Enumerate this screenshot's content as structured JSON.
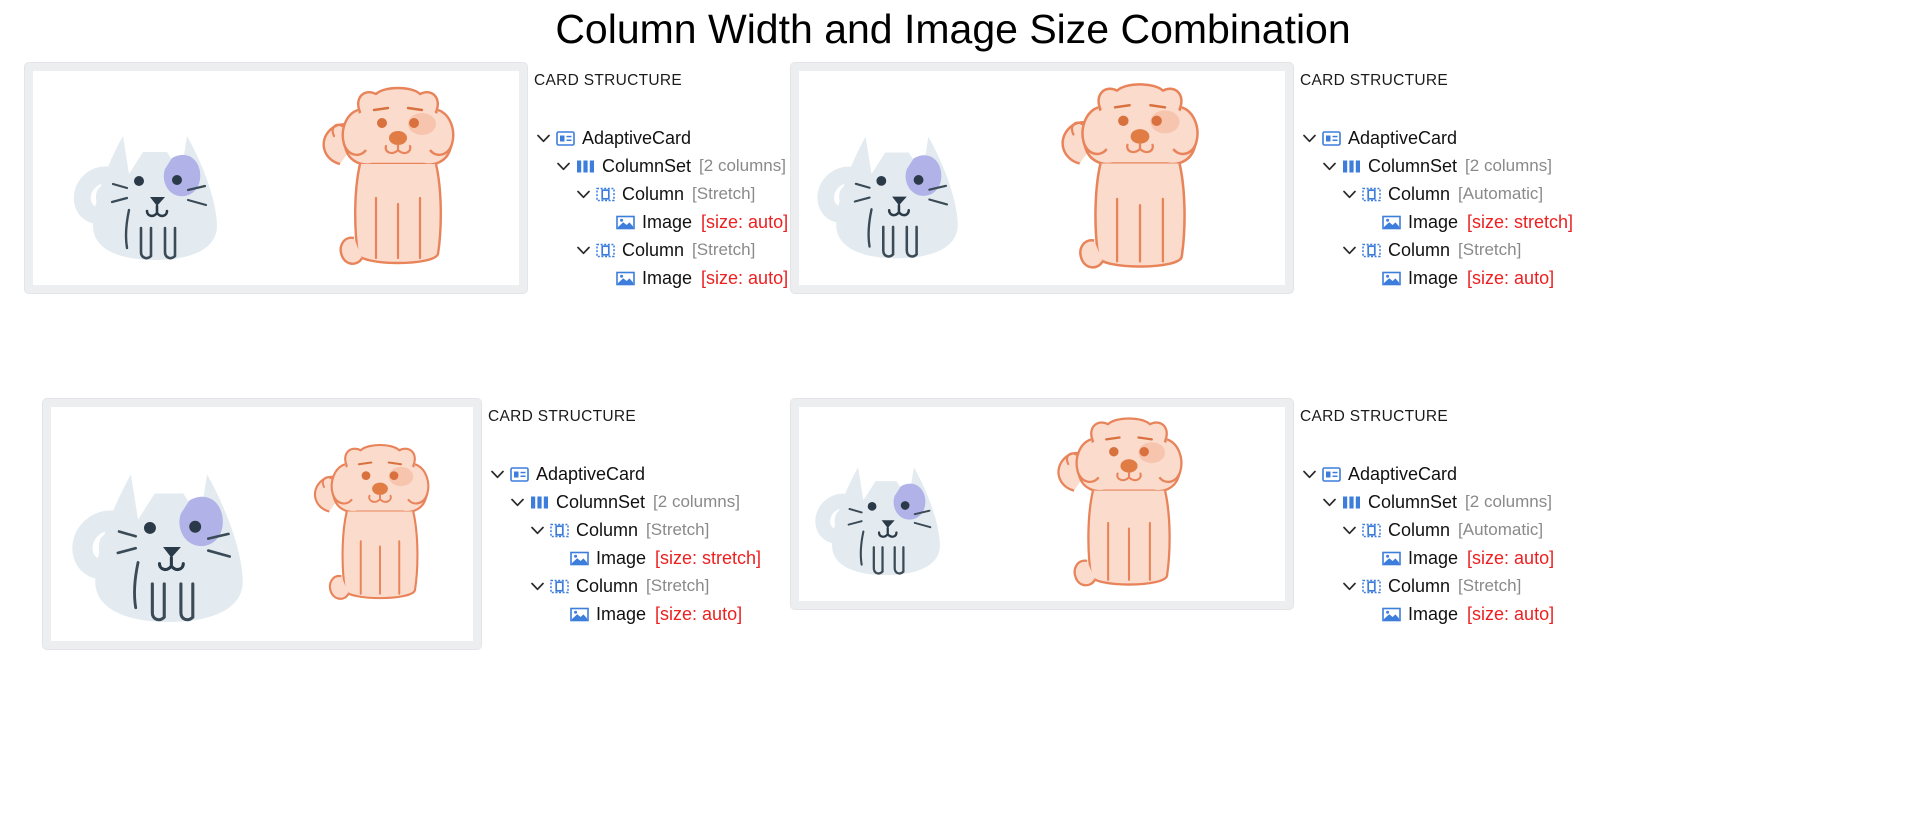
{
  "page": {
    "title": "Column Width and Image Size Combination"
  },
  "common": {
    "structure_heading": "CARD STRUCTURE",
    "node_adaptive_card": "AdaptiveCard",
    "node_columnset": "ColumnSet",
    "node_column": "Column",
    "node_image": "Image",
    "meta_two_columns": "[2 columns]",
    "width_stretch": "[Stretch]",
    "width_automatic": "[Automatic]",
    "size_auto": "[size: auto]",
    "size_stretch": "[size: stretch]",
    "accent_blue": "#3d7ddb",
    "red": "#ec2020",
    "meta_gray": "#8a8a8a",
    "card_frame_bg": "#eceef0",
    "cat_body": "#e3ebf0",
    "cat_ear_patch": "#b0b2e8",
    "cat_line": "#3b4a57",
    "dog_body": "#fadbcc",
    "dog_line": "#e8835a"
  },
  "panels": [
    {
      "id": "panel-1",
      "heading": "CARD STRUCTURE",
      "nodes": [
        {
          "level": 0,
          "chevron": true,
          "icon": "adaptive-card-icon",
          "label": "AdaptiveCard",
          "meta": "",
          "size": ""
        },
        {
          "level": 1,
          "chevron": true,
          "icon": "columnset-icon",
          "label": "ColumnSet",
          "meta": "[2 columns]",
          "size": ""
        },
        {
          "level": 2,
          "chevron": true,
          "icon": "column-icon",
          "label": "Column",
          "meta": "[Stretch]",
          "size": ""
        },
        {
          "level": 3,
          "chevron": false,
          "icon": "image-icon",
          "label": "Image",
          "meta": "",
          "size": "[size: auto]"
        },
        {
          "level": 2,
          "chevron": true,
          "icon": "column-icon",
          "label": "Column",
          "meta": "[Stretch]",
          "size": ""
        },
        {
          "level": 3,
          "chevron": false,
          "icon": "image-icon",
          "label": "Image",
          "meta": "",
          "size": "[size: auto]"
        }
      ]
    },
    {
      "id": "panel-2",
      "heading": "CARD STRUCTURE",
      "nodes": [
        {
          "level": 0,
          "chevron": true,
          "icon": "adaptive-card-icon",
          "label": "AdaptiveCard",
          "meta": "",
          "size": ""
        },
        {
          "level": 1,
          "chevron": true,
          "icon": "columnset-icon",
          "label": "ColumnSet",
          "meta": "[2 columns]",
          "size": ""
        },
        {
          "level": 2,
          "chevron": true,
          "icon": "column-icon",
          "label": "Column",
          "meta": "[Automatic]",
          "size": ""
        },
        {
          "level": 3,
          "chevron": false,
          "icon": "image-icon",
          "label": "Image",
          "meta": "",
          "size": "[size: stretch]"
        },
        {
          "level": 2,
          "chevron": true,
          "icon": "column-icon",
          "label": "Column",
          "meta": "[Stretch]",
          "size": ""
        },
        {
          "level": 3,
          "chevron": false,
          "icon": "image-icon",
          "label": "Image",
          "meta": "",
          "size": "[size: auto]"
        }
      ]
    },
    {
      "id": "panel-3",
      "heading": "CARD STRUCTURE",
      "nodes": [
        {
          "level": 0,
          "chevron": true,
          "icon": "adaptive-card-icon",
          "label": "AdaptiveCard",
          "meta": "",
          "size": ""
        },
        {
          "level": 1,
          "chevron": true,
          "icon": "columnset-icon",
          "label": "ColumnSet",
          "meta": "[2 columns]",
          "size": ""
        },
        {
          "level": 2,
          "chevron": true,
          "icon": "column-icon",
          "label": "Column",
          "meta": "[Stretch]",
          "size": ""
        },
        {
          "level": 3,
          "chevron": false,
          "icon": "image-icon",
          "label": "Image",
          "meta": "",
          "size": "[size: stretch]"
        },
        {
          "level": 2,
          "chevron": true,
          "icon": "column-icon",
          "label": "Column",
          "meta": "[Stretch]",
          "size": ""
        },
        {
          "level": 3,
          "chevron": false,
          "icon": "image-icon",
          "label": "Image",
          "meta": "",
          "size": "[size: auto]"
        }
      ]
    },
    {
      "id": "panel-4",
      "heading": "CARD STRUCTURE",
      "nodes": [
        {
          "level": 0,
          "chevron": true,
          "icon": "adaptive-card-icon",
          "label": "AdaptiveCard",
          "meta": "",
          "size": ""
        },
        {
          "level": 1,
          "chevron": true,
          "icon": "columnset-icon",
          "label": "ColumnSet",
          "meta": "[2 columns]",
          "size": ""
        },
        {
          "level": 2,
          "chevron": true,
          "icon": "column-icon",
          "label": "Column",
          "meta": "[Automatic]",
          "size": ""
        },
        {
          "level": 3,
          "chevron": false,
          "icon": "image-icon",
          "label": "Image",
          "meta": "",
          "size": "[size: auto]"
        },
        {
          "level": 2,
          "chevron": true,
          "icon": "column-icon",
          "label": "Column",
          "meta": "[Stretch]",
          "size": ""
        },
        {
          "level": 3,
          "chevron": false,
          "icon": "image-icon",
          "label": "Image",
          "meta": "",
          "size": "[size: auto]"
        }
      ]
    }
  ],
  "cards": [
    {
      "id": "card-1",
      "columns": [
        {
          "flex": "1 1 50%",
          "pet": "cat",
          "pet_width": 200,
          "pet_height": 200
        },
        {
          "flex": "1 1 50%",
          "pet": "dog",
          "pet_width": 176,
          "pet_height": 196
        }
      ]
    },
    {
      "id": "card-2",
      "columns": [
        {
          "flex": "0 0 auto",
          "pet": "cat",
          "pet_width": 196,
          "pet_height": 200
        },
        {
          "flex": "1 1 auto",
          "pet": "dog",
          "pet_width": 188,
          "pet_height": 204
        }
      ]
    },
    {
      "id": "card-3",
      "columns": [
        {
          "flex": "1 1 56%",
          "pet": "cat",
          "pet_width": 238,
          "pet_height": 238
        },
        {
          "flex": "1 1 44%",
          "pet": "dog",
          "pet_width": 154,
          "pet_height": 172
        }
      ]
    },
    {
      "id": "card-4",
      "columns": [
        {
          "flex": "0 0 auto",
          "pet": "cat",
          "pet_width": 174,
          "pet_height": 180
        },
        {
          "flex": "1 1 auto",
          "pet": "dog",
          "pet_width": 168,
          "pet_height": 186
        }
      ]
    }
  ]
}
